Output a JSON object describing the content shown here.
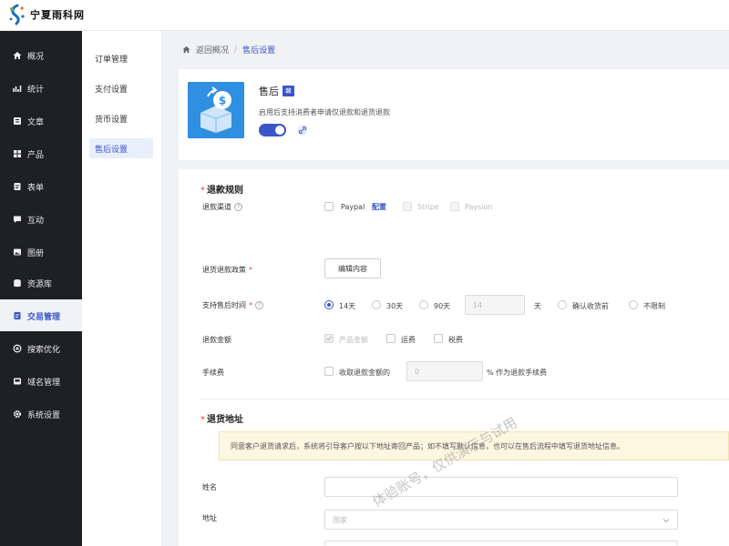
{
  "brand": {
    "name": "宁夏雨科网"
  },
  "sidebar": {
    "items": [
      {
        "label": "概况",
        "icon": "home-icon"
      },
      {
        "label": "统计",
        "icon": "chart-icon"
      },
      {
        "label": "文章",
        "icon": "article-icon"
      },
      {
        "label": "产品",
        "icon": "grid-icon"
      },
      {
        "label": "表单",
        "icon": "form-icon"
      },
      {
        "label": "互动",
        "icon": "chat-icon"
      },
      {
        "label": "图册",
        "icon": "image-icon"
      },
      {
        "label": "资源库",
        "icon": "database-icon"
      },
      {
        "label": "交易管理",
        "icon": "transaction-icon"
      },
      {
        "label": "搜索优化",
        "icon": "seo-icon"
      },
      {
        "label": "域名管理",
        "icon": "domain-icon"
      },
      {
        "label": "系统设置",
        "icon": "gear-icon"
      }
    ]
  },
  "subnav": {
    "items": [
      {
        "label": "订单管理"
      },
      {
        "label": "支付设置"
      },
      {
        "label": "货币设置"
      },
      {
        "label": "售后设置"
      }
    ]
  },
  "breadcrumb": {
    "back": "返回概况",
    "sep": "/",
    "current": "售后设置"
  },
  "app": {
    "title": "售后",
    "tag": "⊠",
    "desc": "启用后支持消费者申请仅退款和退货退款",
    "enabled": true
  },
  "refund": {
    "title": "退款规则",
    "channel_label": "退款渠道",
    "paypal": "Paypal",
    "config": "配置",
    "stripe": "Stripe",
    "paysion": "Paysion",
    "policy_label": "退货退款政策",
    "edit_button": "编辑内容",
    "period_label": "支持售后时间",
    "opt_14": "14天",
    "opt_30": "30天",
    "opt_90": "90天",
    "custom_value": "14",
    "day_unit": "天",
    "opt_confirm": "确认收货前",
    "opt_unlimited": "不限制",
    "amount_label": "退款金额",
    "amount_product": "产品金额",
    "amount_shipping": "运费",
    "amount_tax": "税费",
    "fee_label": "手续费",
    "fee_charge": "收取退款金额的",
    "fee_value": "0",
    "fee_suffix": "% 作为退款手续费"
  },
  "address": {
    "title": "退货地址",
    "notice": "同意客户退货请求后，系统将引导客户按以下地址寄回产品；如不填写默认信息，也可以在售后流程中填写退货地址信息。",
    "name_label": "姓名",
    "addr_label": "地址",
    "country_placeholder": "国家"
  },
  "watermark": "体验账号，仅供演示与试用",
  "colors": {
    "accent": "#3b56c9",
    "sidebar_bg": "#1e2024",
    "app_icon_bg": "#2f8fe0"
  }
}
